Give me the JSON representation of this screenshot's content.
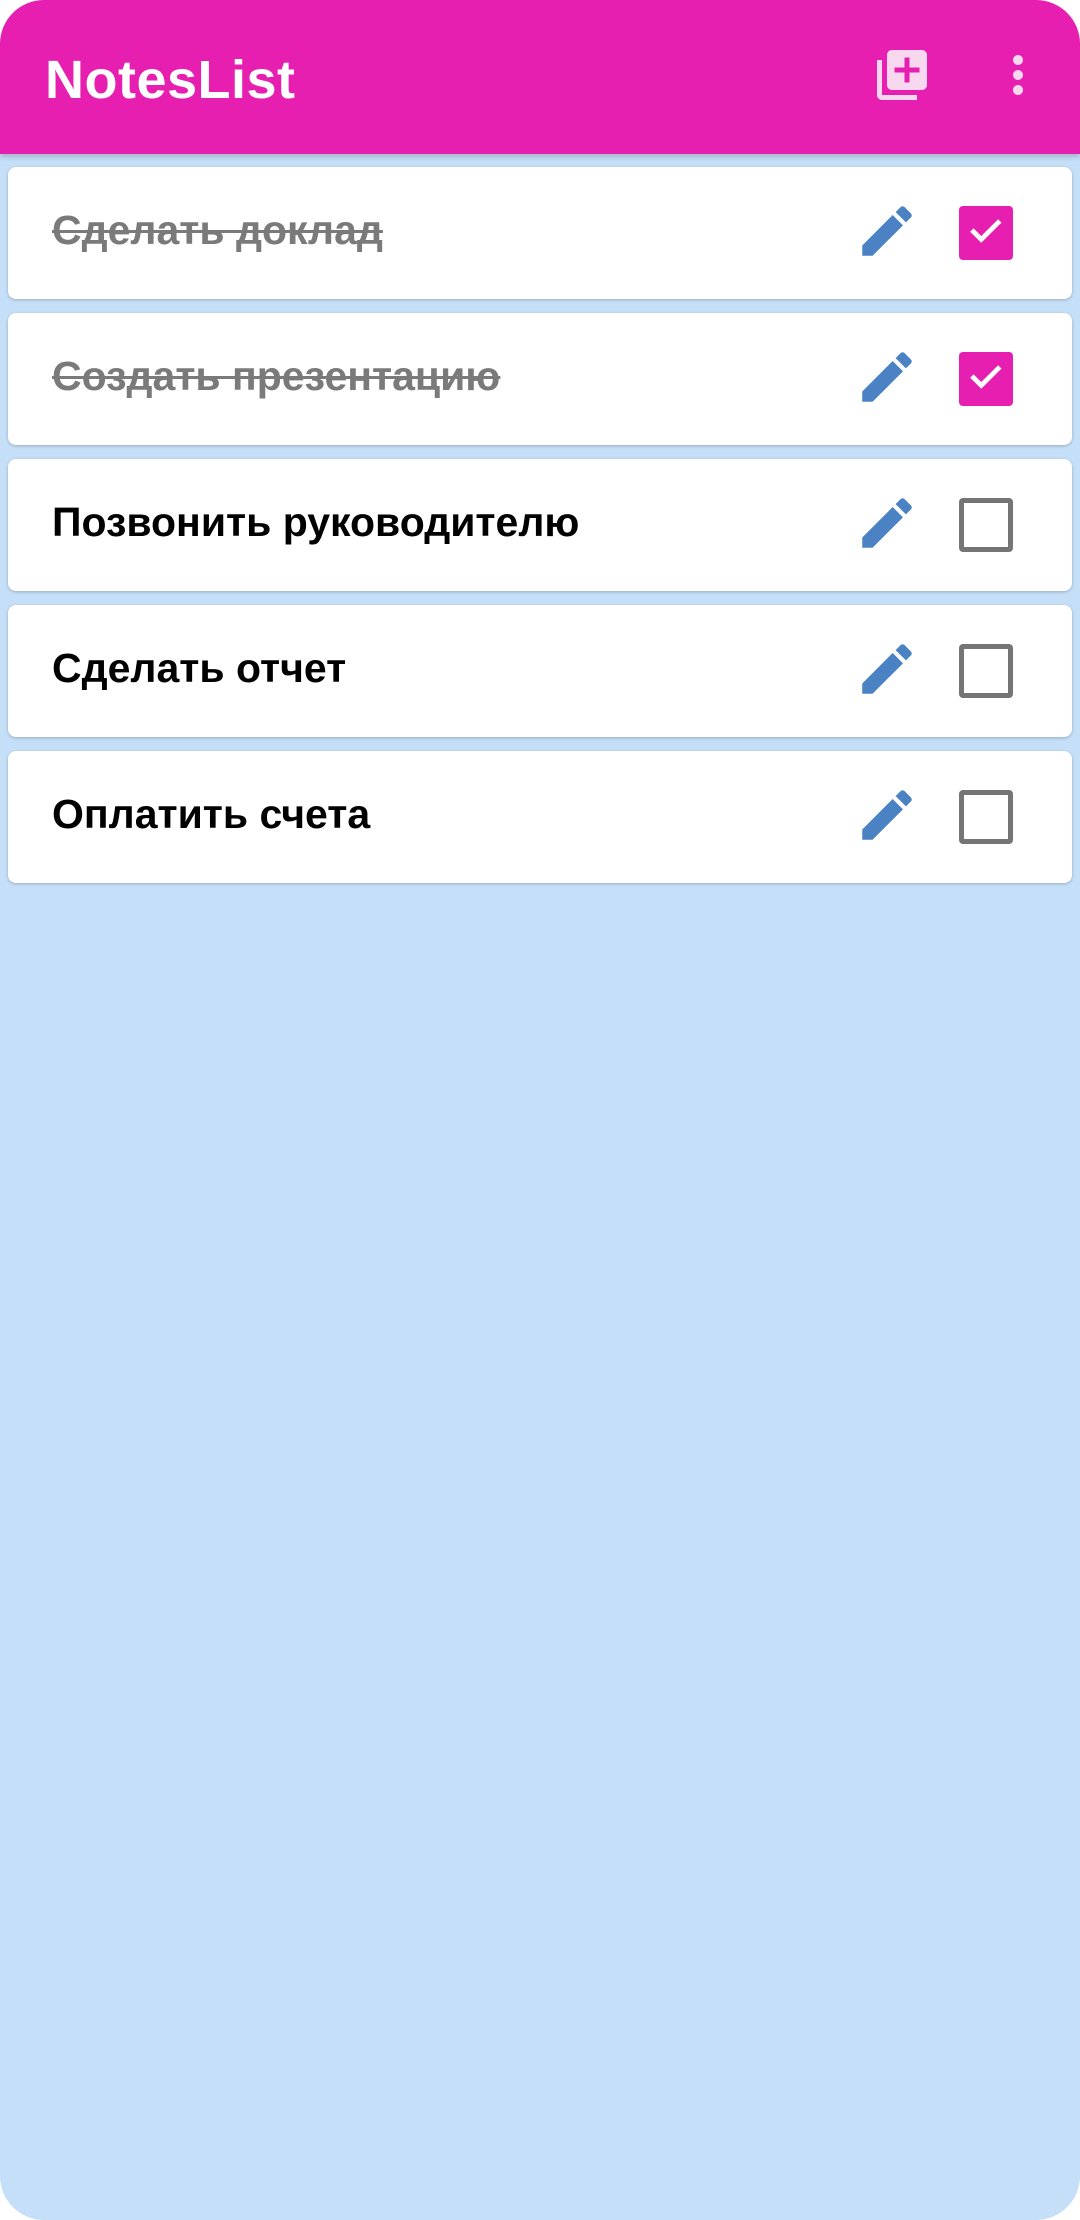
{
  "app_bar": {
    "title": "NotesList",
    "actions": [
      {
        "name": "add-note-button",
        "icon": "library-add-icon"
      },
      {
        "name": "more-options-button",
        "icon": "more-vert-icon"
      }
    ]
  },
  "notes": [
    {
      "text": "Сделать доклад",
      "done": true
    },
    {
      "text": "Создать презентацию",
      "done": true
    },
    {
      "text": "Позвонить руководителю",
      "done": false
    },
    {
      "text": "Сделать отчет",
      "done": false
    },
    {
      "text": "Оплатить счета",
      "done": false
    }
  ],
  "icons": {
    "edit": "pencil-icon",
    "checked": "checkbox-checked-icon",
    "unchecked": "checkbox-unchecked-icon"
  },
  "colors": {
    "accent": "#e61fb0",
    "background": "#c5dff8",
    "edit_icon": "#4a82c4",
    "done_text": "#7a7a7a",
    "checkbox_border": "#757575"
  }
}
